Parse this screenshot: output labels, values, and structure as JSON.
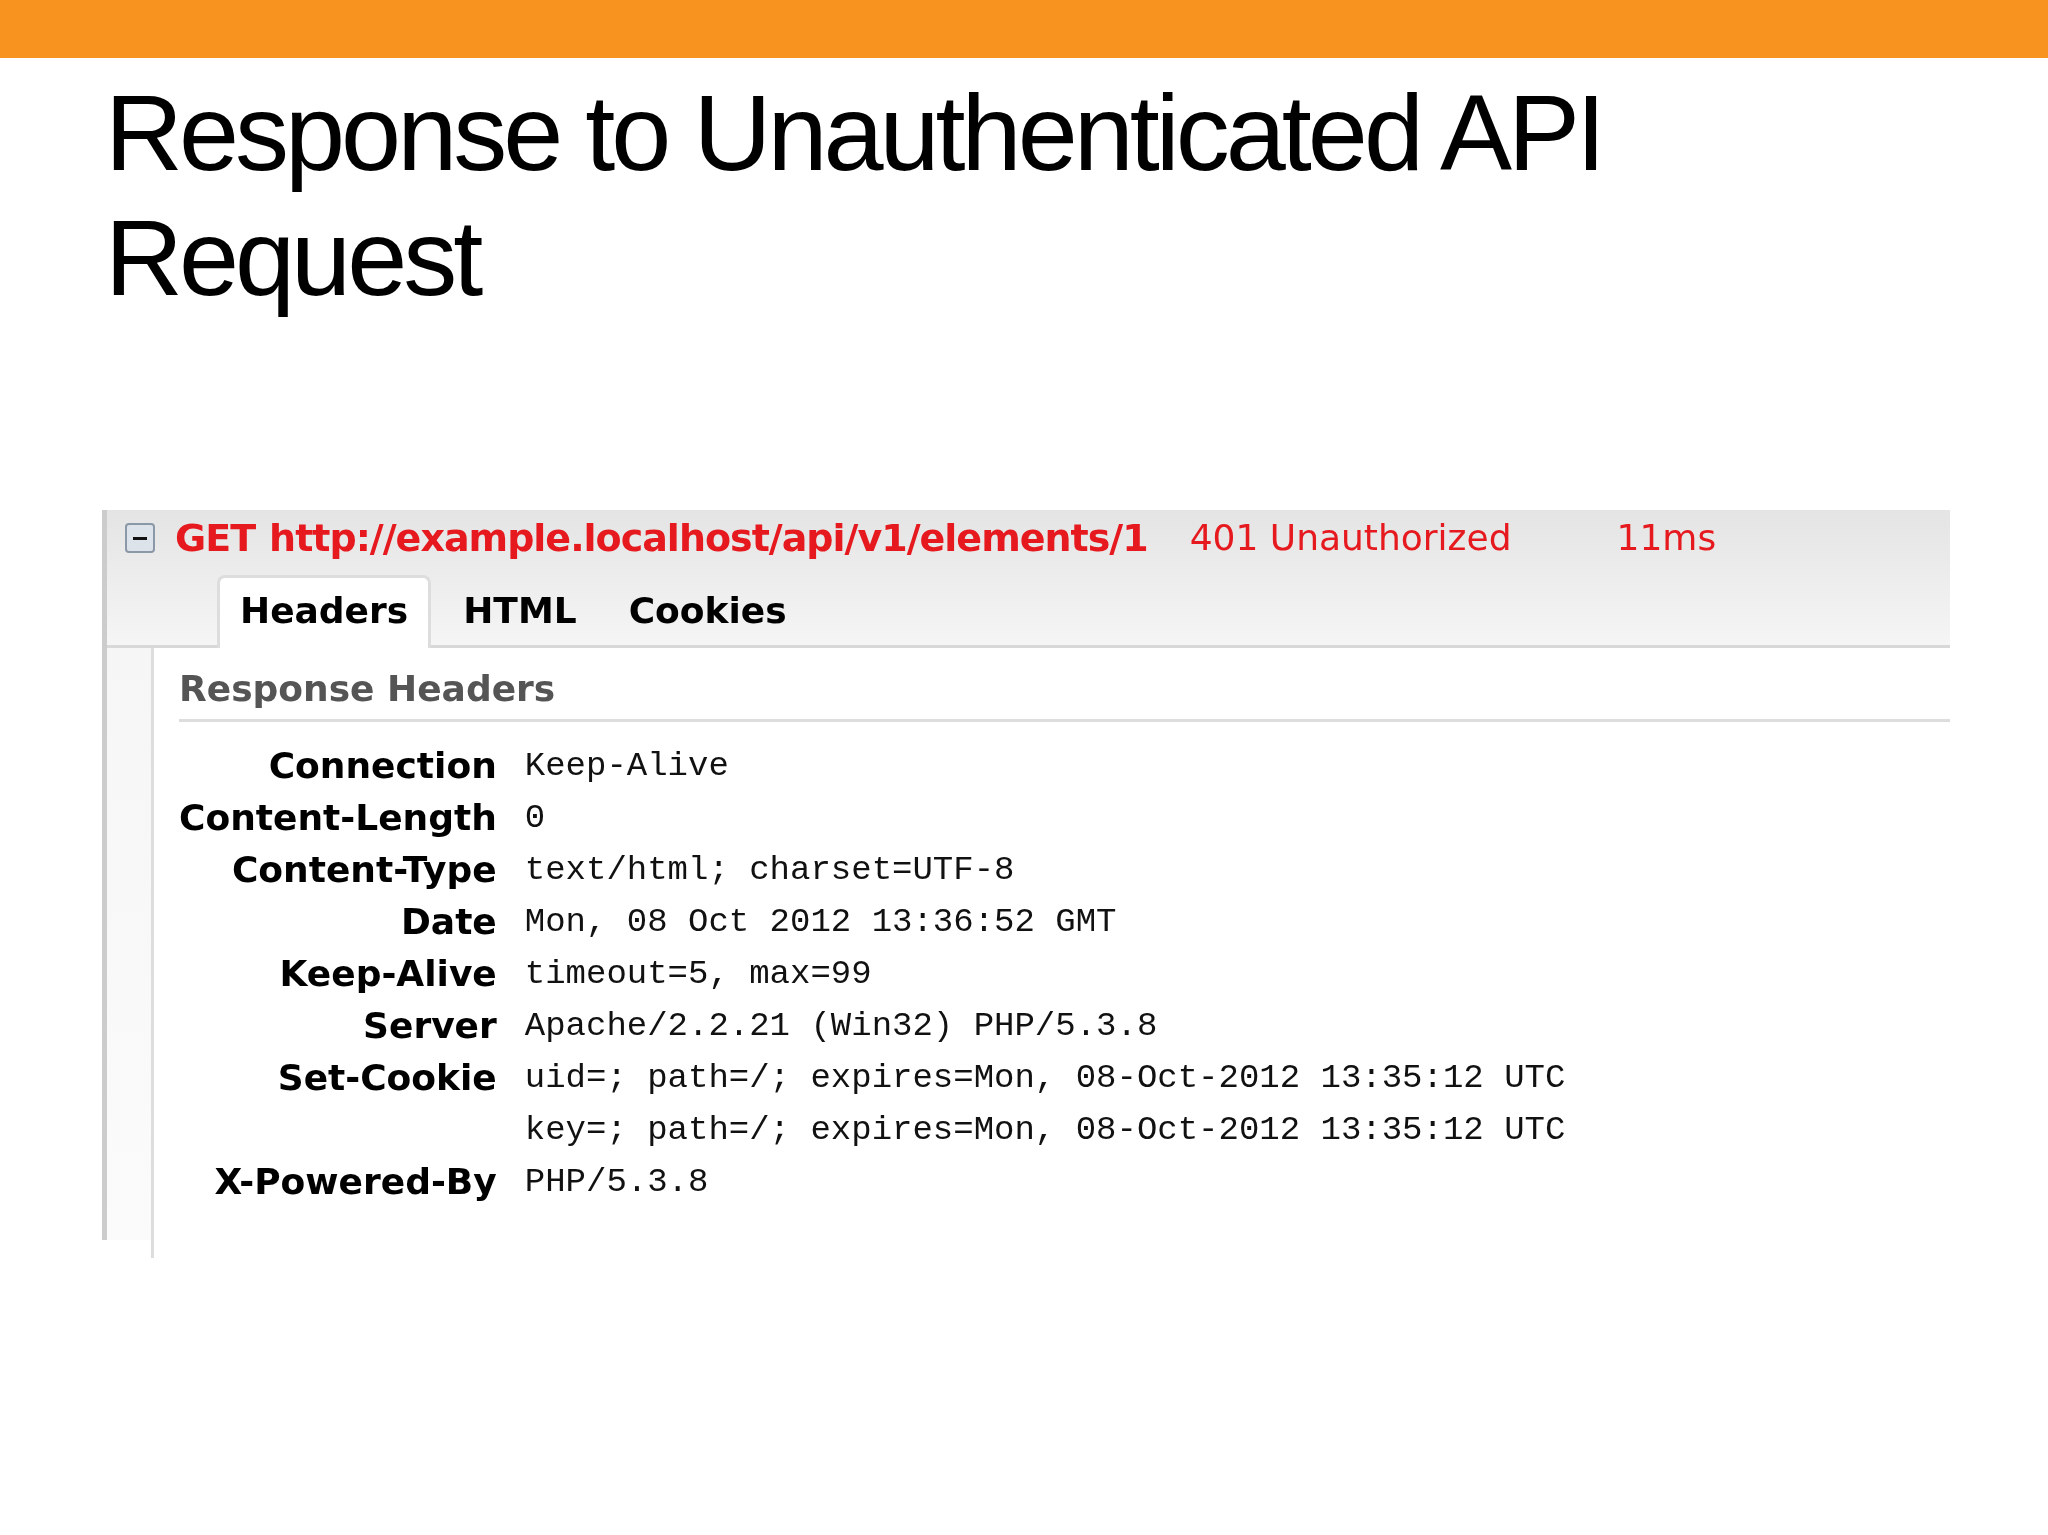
{
  "slide": {
    "title": "Response to Unauthenticated API Request"
  },
  "request": {
    "expanded": true,
    "method": "GET",
    "url": "http://example.localhost/api/v1/elements/1",
    "status": "401 Unauthorized",
    "time": "11ms"
  },
  "tabs": [
    {
      "label": "Headers",
      "selected": true
    },
    {
      "label": "HTML",
      "selected": false
    },
    {
      "label": "Cookies",
      "selected": false
    }
  ],
  "section_title": "Response Headers",
  "headers": [
    {
      "name": "Connection",
      "values": [
        "Keep-Alive"
      ]
    },
    {
      "name": "Content-Length",
      "values": [
        "0"
      ]
    },
    {
      "name": "Content-Type",
      "values": [
        "text/html; charset=UTF-8"
      ]
    },
    {
      "name": "Date",
      "values": [
        "Mon, 08 Oct 2012 13:36:52 GMT"
      ]
    },
    {
      "name": "Keep-Alive",
      "values": [
        "timeout=5, max=99"
      ]
    },
    {
      "name": "Server",
      "values": [
        "Apache/2.2.21 (Win32) PHP/5.3.8"
      ]
    },
    {
      "name": "Set-Cookie",
      "values": [
        "uid=; path=/; expires=Mon, 08-Oct-2012 13:35:12 UTC",
        "key=; path=/; expires=Mon, 08-Oct-2012 13:35:12 UTC"
      ]
    },
    {
      "name": "X-Powered-By",
      "values": [
        "PHP/5.3.8"
      ]
    }
  ]
}
